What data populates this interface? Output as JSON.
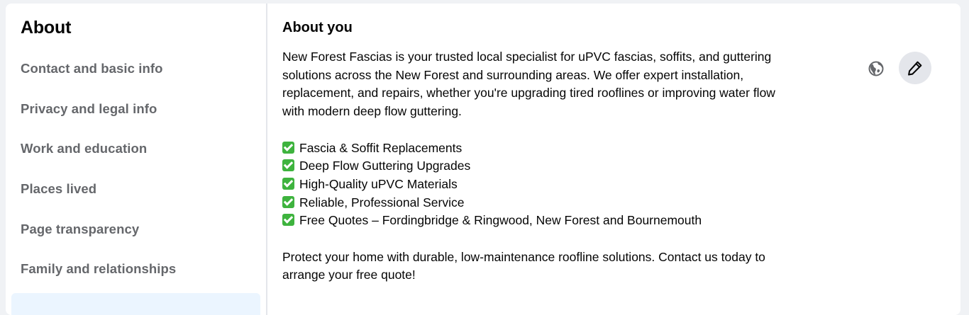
{
  "sidebar": {
    "title": "About",
    "items": [
      {
        "label": "Contact and basic info"
      },
      {
        "label": "Privacy and legal info"
      },
      {
        "label": "Work and education"
      },
      {
        "label": "Places lived"
      },
      {
        "label": "Page transparency"
      },
      {
        "label": "Family and relationships"
      }
    ]
  },
  "main": {
    "section_title": "About you",
    "intro_lines": [
      "New Forest Fascias is your trusted local specialist for uPVC fascias, soffits, and guttering",
      "solutions across the New Forest and surrounding areas. We offer expert installation,",
      "replacement, and repairs, whether you're upgrading tired rooflines or improving water flow",
      "with modern deep flow guttering."
    ],
    "checklist": [
      "Fascia & Soffit Replacements",
      "Deep Flow Guttering Upgrades",
      "High-Quality uPVC Materials",
      "Reliable, Professional Service",
      "Free Quotes – Fordingbridge & Ringwood, New Forest and Bournemouth"
    ],
    "outro_lines": [
      "Protect your home with durable, low-maintenance roofline solutions. Contact us today to",
      "arrange your free quote!"
    ]
  },
  "icons": {
    "audience": "globe-icon",
    "edit": "pencil-icon"
  },
  "colors": {
    "nav_text": "#65676b",
    "selected_bg": "#ebf5ff",
    "check": "#3eb33e",
    "edit_button_bg": "#e4e6eb"
  }
}
